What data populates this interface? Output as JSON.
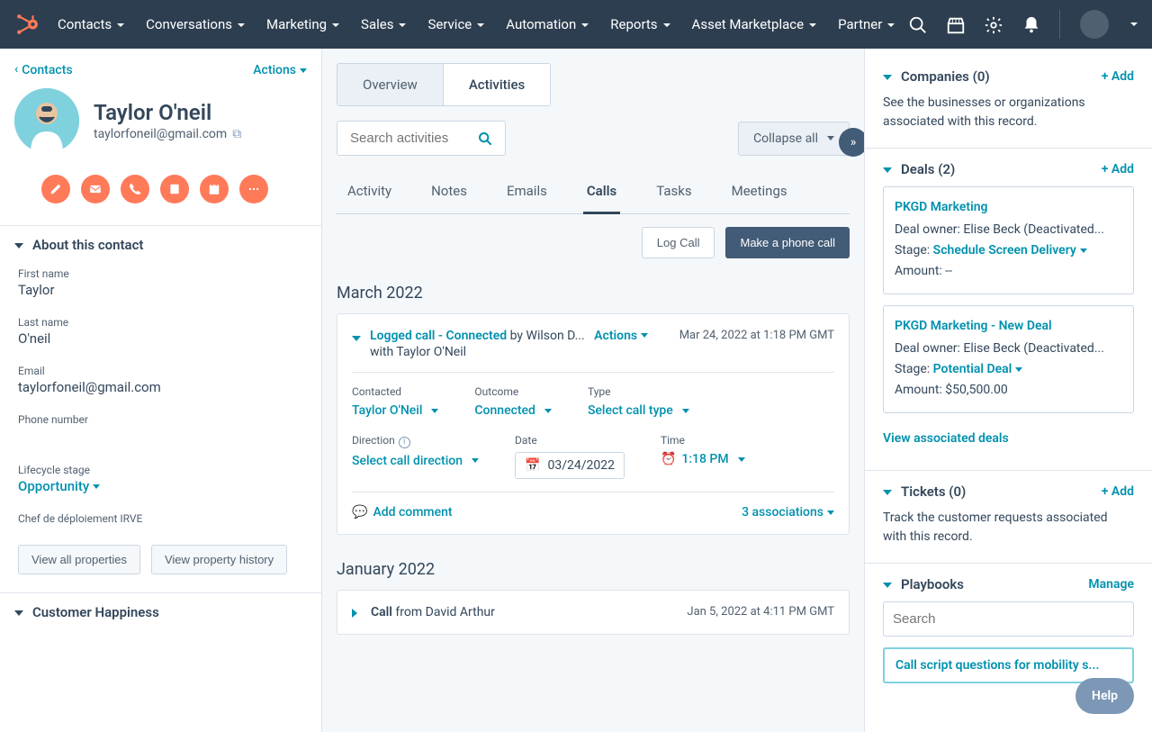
{
  "nav": {
    "items": [
      "Contacts",
      "Conversations",
      "Marketing",
      "Sales",
      "Service",
      "Automation",
      "Reports",
      "Asset Marketplace",
      "Partner"
    ]
  },
  "left": {
    "back": "Contacts",
    "actions": "Actions",
    "name": "Taylor O'neil",
    "email": "taylorfoneil@gmail.com",
    "about_header": "About this contact",
    "fields": {
      "first_name_label": "First name",
      "first_name": "Taylor",
      "last_name_label": "Last name",
      "last_name": "O'neil",
      "email_label": "Email",
      "email": "taylorfoneil@gmail.com",
      "phone_label": "Phone number",
      "phone": "",
      "lifecycle_label": "Lifecycle stage",
      "lifecycle": "Opportunity",
      "chef_label": "Chef de déploiement IRVE"
    },
    "view_all": "View all properties",
    "view_history": "View property history",
    "happiness_header": "Customer Happiness"
  },
  "center": {
    "tabs": {
      "overview": "Overview",
      "activities": "Activities"
    },
    "search_placeholder": "Search activities",
    "collapse": "Collapse all",
    "sub_tabs": [
      "Activity",
      "Notes",
      "Emails",
      "Calls",
      "Tasks",
      "Meetings"
    ],
    "active_sub_tab": "Calls",
    "log_call": "Log Call",
    "make_call": "Make a phone call",
    "month1": "March 2022",
    "card1": {
      "title_bold": "Logged call - Connected",
      "by": " by Wilson D...",
      "with": "with Taylor O'Neil",
      "actions": "Actions",
      "timestamp": "Mar 24, 2022 at 1:18 PM GMT",
      "contacted_label": "Contacted",
      "contacted": "Taylor O'Neil",
      "outcome_label": "Outcome",
      "outcome": "Connected",
      "type_label": "Type",
      "type": "Select call type",
      "direction_label": "Direction",
      "direction": "Select call direction",
      "date_label": "Date",
      "date": "03/24/2022",
      "time_label": "Time",
      "time": "1:18 PM",
      "add_comment": "Add comment",
      "associations": "3 associations"
    },
    "month2": "January 2022",
    "card2": {
      "title_bold": "Call",
      "from": " from David Arthur",
      "timestamp": "Jan 5, 2022 at 4:11 PM GMT"
    }
  },
  "right": {
    "companies": {
      "title": "Companies (0)",
      "add": "+ Add",
      "body": "See the businesses or organizations associated with this record."
    },
    "deals": {
      "title": "Deals (2)",
      "add": "+ Add",
      "items": [
        {
          "name": "PKGD Marketing",
          "owner_label": "Deal owner: ",
          "owner": "Elise Beck (Deactivated...",
          "stage_label": "Stage: ",
          "stage": "Schedule Screen Delivery",
          "amount_label": "Amount: ",
          "amount": "--"
        },
        {
          "name": "PKGD Marketing - New Deal",
          "owner_label": "Deal owner: ",
          "owner": "Elise Beck (Deactivated...",
          "stage_label": "Stage: ",
          "stage": "Potential Deal",
          "amount_label": "Amount: ",
          "amount": "$50,500.00"
        }
      ],
      "view": "View associated deals"
    },
    "tickets": {
      "title": "Tickets (0)",
      "add": "+ Add",
      "body": "Track the customer requests associated with this record."
    },
    "playbooks": {
      "title": "Playbooks",
      "manage": "Manage",
      "search_placeholder": "Search",
      "item": "Call script questions for mobility s..."
    }
  },
  "help": "Help"
}
